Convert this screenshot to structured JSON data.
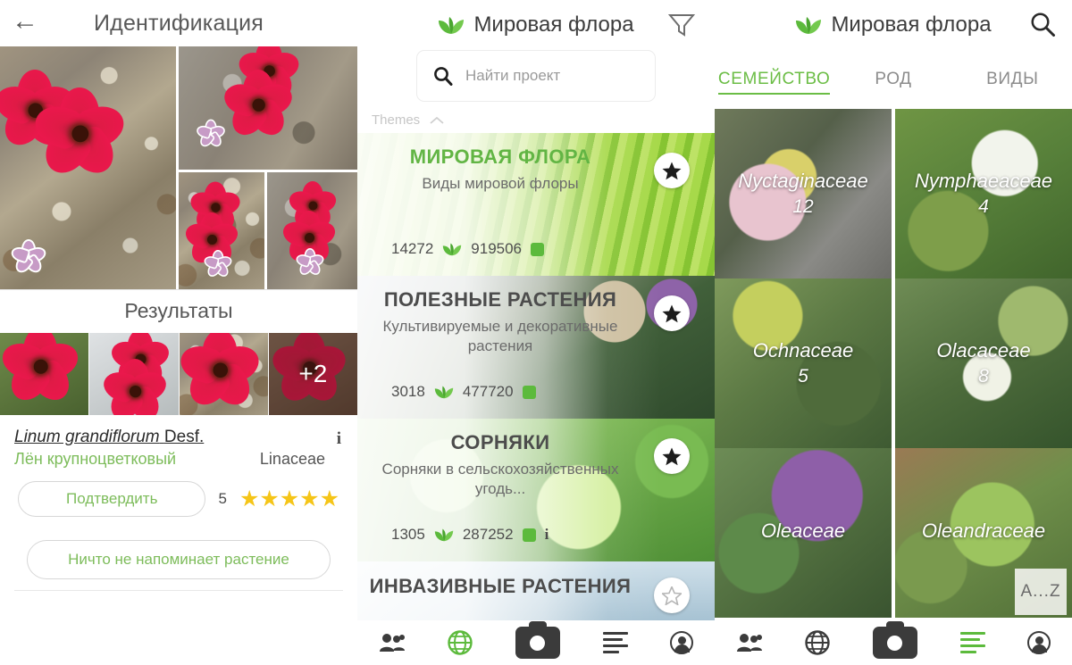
{
  "panel_identification": {
    "header": {
      "back_icon": "back-arrow-icon",
      "title": "Идентификация"
    },
    "photos": [
      {
        "name": "photo-main",
        "marker": "sakura-icon"
      },
      {
        "name": "photo-top-right",
        "marker": "sakura-icon"
      },
      {
        "name": "photo-bottom-1",
        "marker": "sakura-icon"
      },
      {
        "name": "photo-bottom-2",
        "marker": "sakura-icon"
      }
    ],
    "results_title": "Результаты",
    "result_thumbs": [
      {
        "label": ""
      },
      {
        "label": ""
      },
      {
        "label": ""
      },
      {
        "label": "+2"
      }
    ],
    "taxon": {
      "scientific_name": "Linum grandiflorum",
      "author": "Desf.",
      "common_name": "Лён крупноцветковый",
      "family": "Linaceae",
      "info_icon": "info-icon"
    },
    "confirm_button": "Подтвердить",
    "vote_count": "5",
    "stars": "★★★★★",
    "nothing_button": "Ничто не напоминает растение"
  },
  "panel_projects": {
    "header": {
      "logo_icon": "leaf-logo-icon",
      "title": "Мировая флора",
      "filter_icon": "filter-icon"
    },
    "search": {
      "icon": "search-icon",
      "placeholder": "Найти проект",
      "value": ""
    },
    "themes": {
      "label": "Themes",
      "chevron_icon": "chevron-up-icon"
    },
    "projects": [
      {
        "title": "МИРОВАЯ ФЛОРА",
        "description": "Виды мировой флоры",
        "species_count": "14272",
        "leaf_icon": "leaf-icon",
        "observation_count": "919506",
        "badge_icon": "green-square-icon",
        "info_icon": "",
        "star_icon": "star-filled-icon",
        "highlighted": true
      },
      {
        "title": "ПОЛЕЗНЫЕ РАСТЕНИЯ",
        "description": "Культивируемые и декоративные растения",
        "species_count": "3018",
        "leaf_icon": "leaf-icon",
        "observation_count": "477720",
        "badge_icon": "green-square-icon",
        "info_icon": "",
        "star_icon": "star-filled-icon",
        "highlighted": false
      },
      {
        "title": "СОРНЯКИ",
        "description": "Сорняки в сельскохозяйственных угодь...",
        "species_count": "1305",
        "leaf_icon": "leaf-icon",
        "observation_count": "287252",
        "badge_icon": "green-square-icon",
        "info_icon": "i",
        "star_icon": "star-filled-icon",
        "highlighted": false
      },
      {
        "title": "ИНВАЗИВНЫЕ РАСТЕНИЯ",
        "description": "",
        "species_count": "",
        "leaf_icon": "",
        "observation_count": "",
        "badge_icon": "",
        "info_icon": "",
        "star_icon": "star-outline-icon",
        "highlighted": false
      }
    ],
    "bottom_nav": [
      {
        "icon": "people-icon",
        "active": false
      },
      {
        "icon": "globe-icon",
        "active": true
      },
      {
        "icon": "camera-icon",
        "active": false
      },
      {
        "icon": "list-icon",
        "active": false
      },
      {
        "icon": "profile-icon",
        "active": false
      }
    ]
  },
  "panel_families": {
    "header": {
      "logo_icon": "leaf-logo-icon",
      "title": "Мировая флора",
      "search_icon": "search-icon"
    },
    "tabs": [
      {
        "label": "СЕМЕЙСТВО",
        "active": true
      },
      {
        "label": "РОД",
        "active": false
      },
      {
        "label": "ВИДЫ",
        "active": false
      }
    ],
    "families": [
      {
        "name": "Nyctaginaceae",
        "count": "12"
      },
      {
        "name": "Nymphaeaceae",
        "count": "4"
      },
      {
        "name": "Ochnaceae",
        "count": "5"
      },
      {
        "name": "Olacaceae",
        "count": "8"
      },
      {
        "name": "Oleaceae",
        "count": ""
      },
      {
        "name": "Oleandraceae",
        "count": ""
      }
    ],
    "az_index_button": "A...Z",
    "bottom_nav": [
      {
        "icon": "people-icon",
        "active": false
      },
      {
        "icon": "globe-icon",
        "active": false
      },
      {
        "icon": "camera-icon",
        "active": false
      },
      {
        "icon": "list-icon",
        "active": true
      },
      {
        "icon": "profile-icon",
        "active": false
      }
    ]
  },
  "colors": {
    "accent_green": "#6bbd45",
    "brand_green": "#5cba3c",
    "star_yellow": "#f5c518",
    "text_dark": "#3c3c3c",
    "text_muted": "#8c8c8c"
  }
}
